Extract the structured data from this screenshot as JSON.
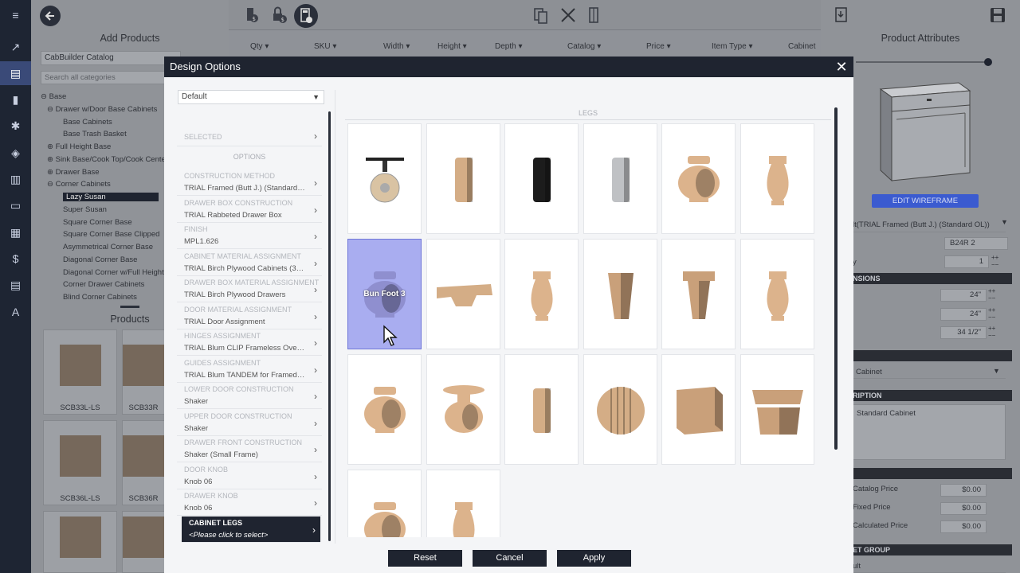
{
  "rail": {
    "icons": [
      "menu-icon",
      "chart-icon",
      "document-icon",
      "book-icon",
      "tools-icon",
      "layers-icon",
      "list-icon",
      "layout-icon",
      "grid-icon",
      "dollar-icon",
      "copy-icon",
      "text-icon"
    ]
  },
  "left_panel": {
    "title": "Add Products",
    "catalog": "CabBuilder Catalog",
    "search_placeholder": "Search all categories",
    "tree": [
      {
        "label": "Base",
        "level": 0,
        "prefix": "⊖"
      },
      {
        "label": "Drawer w/Door Base Cabinets",
        "level": 1,
        "prefix": "⊖"
      },
      {
        "label": "Base Cabinets",
        "level": 2,
        "prefix": ""
      },
      {
        "label": "Base Trash Basket",
        "level": 2,
        "prefix": ""
      },
      {
        "label": "Full Height Base",
        "level": 1,
        "prefix": "⊕"
      },
      {
        "label": "Sink Base/Cook Top/Cook Center",
        "level": 1,
        "prefix": "⊕"
      },
      {
        "label": "Drawer Base",
        "level": 1,
        "prefix": "⊕"
      },
      {
        "label": "Corner Cabinets",
        "level": 1,
        "prefix": "⊖"
      },
      {
        "label": "Lazy Susan",
        "level": 2,
        "prefix": "",
        "selected": true
      },
      {
        "label": "Super Susan",
        "level": 2,
        "prefix": ""
      },
      {
        "label": "Square Corner Base",
        "level": 2,
        "prefix": ""
      },
      {
        "label": "Square Corner Base Clipped",
        "level": 2,
        "prefix": ""
      },
      {
        "label": "Asymmetrical Corner Base",
        "level": 2,
        "prefix": ""
      },
      {
        "label": "Diagonal Corner Base",
        "level": 2,
        "prefix": ""
      },
      {
        "label": "Diagonal Corner w/Full Height Do",
        "level": 2,
        "prefix": ""
      },
      {
        "label": "Corner Drawer Cabinets",
        "level": 2,
        "prefix": ""
      },
      {
        "label": "Blind Corner Cabinets",
        "level": 2,
        "prefix": ""
      }
    ],
    "products_title": "Products",
    "products": [
      "SCB33L-LS",
      "SCB33R",
      "SCB36L-LS",
      "SCB36R"
    ]
  },
  "toolbar": {
    "columns": [
      "Qty",
      "SKU",
      "Width",
      "Height",
      "Depth",
      "Catalog",
      "Price",
      "Item Type",
      "Cabinet"
    ]
  },
  "right_panel": {
    "title": "Product Attributes",
    "edit_button": "EDIT WIREFRAME",
    "construction": "lt(TRIAL Framed (Butt J.) (Standard OL))",
    "sku": "B24R 2",
    "qty_label": "y",
    "qty": "1",
    "dimensions_label": "NSIONS",
    "width": "24\"",
    "depth": "24\"",
    "height_label": "t",
    "height": "34 1/2\"",
    "type": "Cabinet",
    "description_label": "RIPTION",
    "description": "Standard Cabinet",
    "catalog_price_label": "Catalog Price",
    "catalog_price": "$0.00",
    "fixed_price_label": "Fixed Price",
    "fixed_price": "$0.00",
    "calculated_price_label": "Calculated Price",
    "calculated_price": "$0.00",
    "group_label": "ET GROUP",
    "group_value": "ult"
  },
  "modal": {
    "title": "Design Options",
    "close": "✕",
    "preset": "Default",
    "selected_label": "SELECTED",
    "options_label": "OPTIONS",
    "options": [
      {
        "title": "CONSTRUCTION METHOD",
        "value": "TRIAL Framed (Butt J.) (Standard OL)"
      },
      {
        "title": "DRAWER BOX CONSTRUCTION",
        "value": "TRIAL Rabbeted Drawer Box"
      },
      {
        "title": "FINISH",
        "value": "MPL1.626"
      },
      {
        "title": "CABINET MATERIAL ASSIGNMENT",
        "value": "TRIAL Birch Plywood Cabinets (3/4\" ..."
      },
      {
        "title": "DRAWER BOX MATERIAL ASSIGNMENT",
        "value": "TRIAL Birch Plywood Drawers"
      },
      {
        "title": "DOOR MATERIAL ASSIGNMENT",
        "value": "TRIAL Door Assignment"
      },
      {
        "title": "HINGES ASSIGNMENT",
        "value": "TRIAL Blum CLIP Frameless Overlay ..."
      },
      {
        "title": "GUIDES ASSIGNMENT",
        "value": "TRIAL Blum TANDEM for Framed Ca..."
      },
      {
        "title": "LOWER DOOR CONSTRUCTION",
        "value": "Shaker"
      },
      {
        "title": "UPPER DOOR CONSTRUCTION",
        "value": "Shaker"
      },
      {
        "title": "DRAWER FRONT CONSTRUCTION",
        "value": "Shaker (Small Frame)"
      },
      {
        "title": "DOOR KNOB",
        "value": "Knob 06"
      },
      {
        "title": "DRAWER KNOB",
        "value": "Knob 06"
      },
      {
        "title": "CABINET LEGS",
        "value": "<Please click to select>",
        "active": true
      }
    ],
    "grid_title": "LEGS",
    "legs": [
      {
        "shape": "caster",
        "color": "#d9c3a3"
      },
      {
        "shape": "cylinder",
        "color": "#d4ad86"
      },
      {
        "shape": "cylinder",
        "color": "#1c1c1c"
      },
      {
        "shape": "cylinder",
        "color": "#bfc1c4"
      },
      {
        "shape": "bun",
        "color": "#dcb38c"
      },
      {
        "shape": "vase",
        "color": "#dcb38c"
      },
      {
        "shape": "bun",
        "color": "#8f8fcf",
        "label": "Bun Foot 3",
        "selected": true
      },
      {
        "shape": "bracket",
        "color": "#d4ad86"
      },
      {
        "shape": "vase",
        "color": "#dcb38c"
      },
      {
        "shape": "tapered",
        "color": "#c9a07a"
      },
      {
        "shape": "tapered-cap",
        "color": "#c9a07a"
      },
      {
        "shape": "vase",
        "color": "#dcb38c"
      },
      {
        "shape": "bun",
        "color": "#dcb38c"
      },
      {
        "shape": "spool",
        "color": "#dcb38c"
      },
      {
        "shape": "cylinder",
        "color": "#d4ad86"
      },
      {
        "shape": "ribbed",
        "color": "#d4ad86"
      },
      {
        "shape": "block",
        "color": "#c9a07a"
      },
      {
        "shape": "block-cap",
        "color": "#c9a07a"
      },
      {
        "shape": "bun",
        "color": "#dcb38c"
      },
      {
        "shape": "vase",
        "color": "#dcb38c"
      }
    ],
    "buttons": {
      "reset": "Reset",
      "cancel": "Cancel",
      "apply": "Apply"
    }
  }
}
